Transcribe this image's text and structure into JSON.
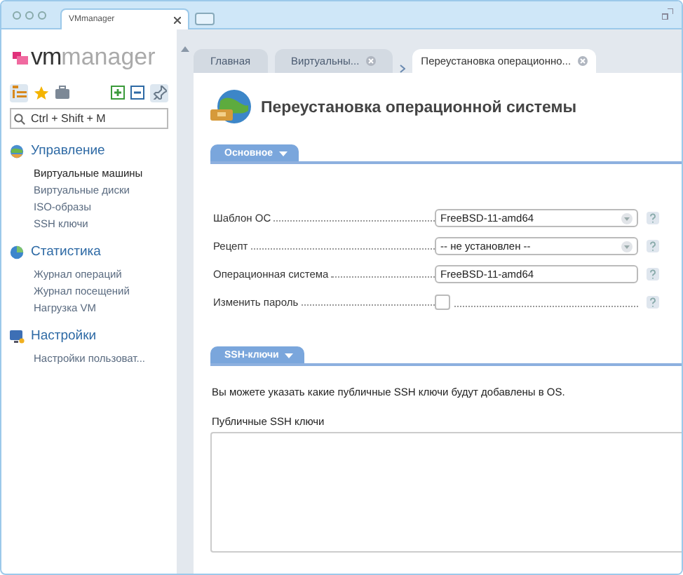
{
  "browser": {
    "tab_title": "VMmanager"
  },
  "logo": {
    "strong": "vm",
    "light": "manager"
  },
  "sidebar": {
    "search": {
      "placeholder": "Ctrl + Shift + M"
    },
    "groups": [
      {
        "title": "Управление",
        "items": [
          {
            "label": "Виртуальные машины",
            "selected": true
          },
          {
            "label": "Виртуальные диски",
            "selected": false
          },
          {
            "label": "ISO-образы",
            "selected": false
          },
          {
            "label": "SSH ключи",
            "selected": false
          }
        ]
      },
      {
        "title": "Статистика",
        "items": [
          {
            "label": "Журнал операций",
            "selected": false
          },
          {
            "label": "Журнал посещений",
            "selected": false
          },
          {
            "label": "Нагрузка VM",
            "selected": false
          }
        ]
      },
      {
        "title": "Настройки",
        "items": [
          {
            "label": "Настройки пользоват...",
            "selected": false
          }
        ]
      }
    ]
  },
  "tabs": [
    {
      "label": "Главная",
      "selected": false,
      "closable": false
    },
    {
      "label": "Виртуальны...",
      "selected": false,
      "closable": true
    },
    {
      "label": "Переустановка операционно...",
      "selected": true,
      "closable": true
    }
  ],
  "page_title": "Переустановка операционной системы",
  "sections": [
    {
      "title": "Основное",
      "kind": "form",
      "rows": [
        {
          "label": "Шаблон ОС",
          "kind": "select",
          "value": "FreeBSD-11-amd64"
        },
        {
          "label": "Рецепт",
          "kind": "select",
          "value": "-- не установлен --"
        },
        {
          "label": "Операционная система",
          "kind": "input",
          "value": "FreeBSD-11-amd64"
        },
        {
          "label": "Изменить пароль",
          "kind": "checkbox",
          "checked": false
        }
      ]
    },
    {
      "title": "SSH-ключи",
      "kind": "keys",
      "note": "Вы можете указать какие публичные SSH ключи будут добавлены в OS.",
      "field_label": "Публичные SSH ключи"
    }
  ]
}
